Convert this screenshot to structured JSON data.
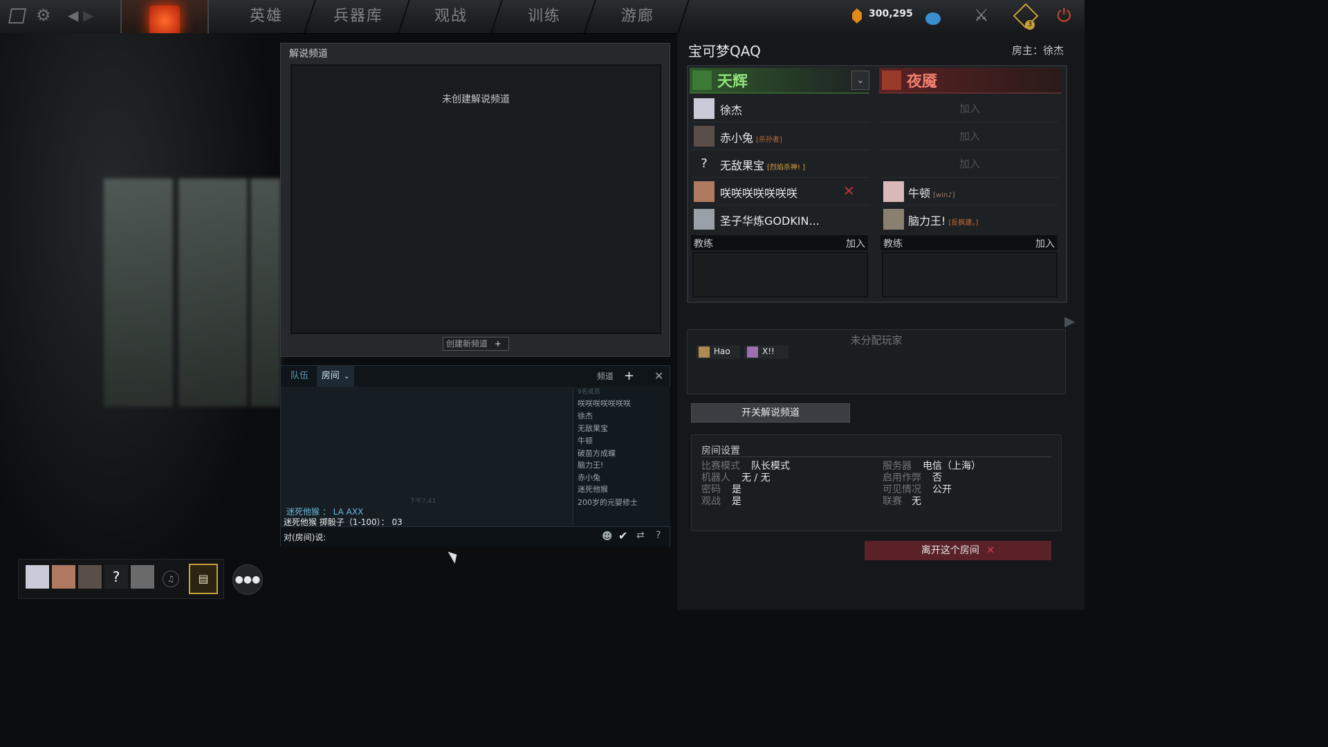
{
  "nav": {
    "items": [
      "英雄",
      "兵器库",
      "观战",
      "训练",
      "游廊"
    ],
    "currency": "300,295",
    "notification_count": "3"
  },
  "caster": {
    "title": "解说频道",
    "empty_text": "未创建解说频道",
    "create_button": "创建新频道"
  },
  "chat": {
    "tab_team": "队伍",
    "tab_room": "房间",
    "channels_label": "频道",
    "member_count": "9名成员",
    "members": [
      "咲咲咲咲咲咲咲",
      "徐杰",
      "无敌果宝",
      "牛顿",
      "破苗方成蝶",
      "脑力王!",
      "赤小兔",
      "迷死他猴",
      "200岁的元婴修士"
    ],
    "timestamp": "下午7:41",
    "messages": [
      {
        "sender": "迷死他猴",
        "text": "LA AXX"
      },
      {
        "sender": "迷死他猴 掷骰子（1-100）：",
        "text": "03"
      }
    ],
    "input_label": "对(房间)说:"
  },
  "room": {
    "title": "宝可梦QAQ",
    "host_label": "房主：徐杰",
    "radiant": "天辉",
    "dire": "夜魇",
    "join_label": "加入",
    "coach_label": "教练",
    "radiant_players": [
      {
        "name": "徐杰",
        "tag": ""
      },
      {
        "name": "赤小兔",
        "tag": "[杀孙者]"
      },
      {
        "name": "无敌果宝",
        "tag": "[烈焰杀神! ]"
      },
      {
        "name": "咲咲咲咲咲咲咲",
        "tag": ""
      },
      {
        "name": "圣子华炼GODKIN...",
        "tag": ""
      }
    ],
    "dire_players": [
      {
        "name": "",
        "tag": ""
      },
      {
        "name": "",
        "tag": ""
      },
      {
        "name": "",
        "tag": ""
      },
      {
        "name": "牛顿",
        "tag": "[win♪]"
      },
      {
        "name": "脑力王!",
        "tag": "[反枫建。]"
      }
    ],
    "unassigned_title": "未分配玩家",
    "unassigned": [
      "Hao",
      "X!!"
    ],
    "toggle_caster": "开关解说频道",
    "leave": "离开这个房间"
  },
  "settings": {
    "title": "房间设置",
    "left": [
      {
        "label": "比赛模式",
        "value": "队长模式"
      },
      {
        "label": "机器人",
        "value": "无 / 无"
      },
      {
        "label": "密码",
        "value": "是"
      },
      {
        "label": "观战",
        "value": "是"
      }
    ],
    "right": [
      {
        "label": "服务器",
        "value": "电信（上海）"
      },
      {
        "label": "启用作弊",
        "value": "否"
      },
      {
        "label": "可见情况",
        "value": "公开"
      },
      {
        "label": "联赛",
        "value": "无"
      }
    ]
  },
  "colors": {
    "radiant": "#7ec95a",
    "dire": "#e04a3a",
    "accent": "#5b9ab5"
  }
}
